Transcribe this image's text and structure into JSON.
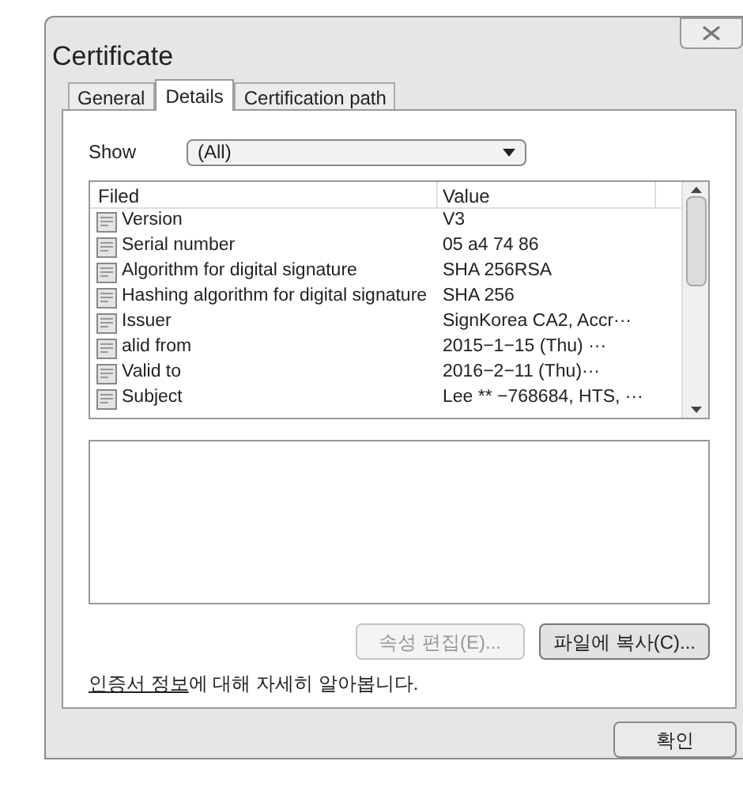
{
  "window": {
    "title": "Certificate"
  },
  "tabs": [
    {
      "label": "General",
      "selected": false
    },
    {
      "label": "Details",
      "selected": true
    },
    {
      "label": "Certification path",
      "selected": false
    }
  ],
  "show": {
    "label": "Show",
    "value": "(All)"
  },
  "table": {
    "columns": [
      "Filed",
      "Value"
    ],
    "rows": [
      {
        "field": "Version",
        "value": "V3"
      },
      {
        "field": "Serial number",
        "value": "05 a4 74 86"
      },
      {
        "field": "Algorithm for digital signature",
        "value": "SHA 256RSA"
      },
      {
        "field": "Hashing algorithm for digital signature",
        "value": "SHA 256"
      },
      {
        "field": "Issuer",
        "value": "SignKorea CA2, Accr···"
      },
      {
        "field": "alid from",
        "value": "2015−1−15 (Thu) ···"
      },
      {
        "field": "Valid to",
        "value": "2016−2−11 (Thu)···"
      },
      {
        "field": "Subject",
        "value": "Lee ** −768684, HTS, ···"
      }
    ]
  },
  "buttons": [
    {
      "label": "속성 편집(E)...",
      "disabled": true
    },
    {
      "label": "파일에 복사(C)...",
      "disabled": false
    }
  ],
  "learn_more": {
    "link": "인증서 정보",
    "text": "에 대해 자세히 알아봅니다."
  },
  "ok_button": {
    "label": "확인"
  }
}
